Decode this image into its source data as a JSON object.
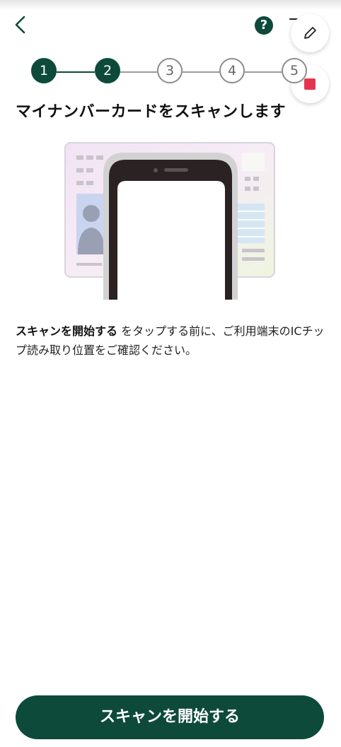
{
  "header": {
    "help_glyph": "?"
  },
  "stepper": {
    "steps": [
      "1",
      "2",
      "3",
      "4",
      "5"
    ],
    "current": 2
  },
  "main": {
    "title": "マイナンバーカードをスキャンします",
    "description_bold": "スキャンを開始する",
    "description_rest": " をタップする前に、ご利用端末のICチップ読み取り位置をご確認ください。"
  },
  "footer": {
    "start_button_label": "スキャンを開始する"
  },
  "colors": {
    "primary": "#0d4a3a",
    "stop": "#e4354f"
  }
}
